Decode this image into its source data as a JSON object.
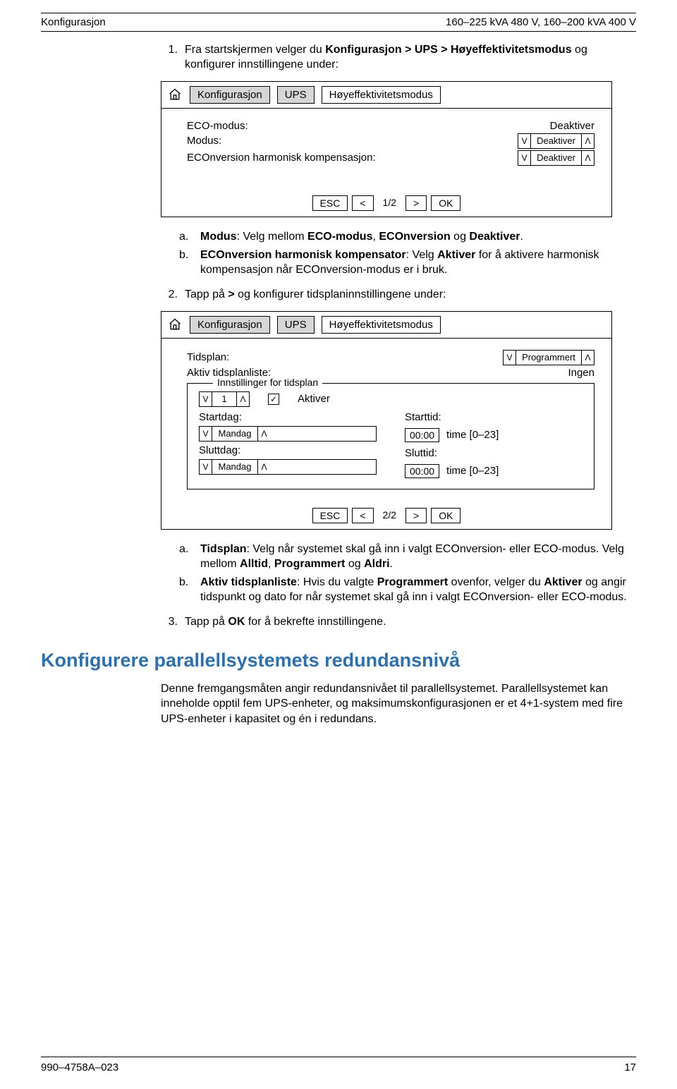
{
  "header": {
    "left": "Konfigurasjon",
    "right": "160–225 kVA 480 V, 160–200 kVA 400 V"
  },
  "step1": {
    "num": "1.",
    "text_a": "Fra startskjermen velger du ",
    "path": "Konfigurasjon > UPS > Høyeffektivitetsmodus",
    "text_b": " og konfigurer innstillingene under:"
  },
  "panel1": {
    "crumb1": "Konfigurasjon",
    "crumb2": "UPS",
    "crumb3": "Høyeffektivitetsmodus",
    "rows": {
      "eco_label": "ECO-modus:",
      "eco_value": "Deaktiver",
      "modus_label": "Modus:",
      "modus_value": "Deaktiver",
      "harm_label": "ECOnversion harmonisk kompensasjon:",
      "harm_value": "Deaktiver"
    },
    "nav": {
      "esc": "ESC",
      "prev": "<",
      "page": "1/2",
      "next": ">",
      "ok": "OK"
    }
  },
  "sublist1": {
    "a": {
      "letter": "a.",
      "lead": "Modus",
      "rest": ": Velg mellom ",
      "opts": "ECO-modus",
      "c1": ", ",
      "opt2": "ECOnversion",
      "c2": " og ",
      "opt3": "Deaktiver",
      "end": "."
    },
    "b": {
      "letter": "b.",
      "lead": "ECOnversion harmonisk kompensator",
      "rest": ": Velg ",
      "opt1": "Aktiver",
      "rest2": " for å aktivere harmonisk kompensasjon når ECOnversion-modus er i bruk."
    }
  },
  "step2": {
    "num": "2.",
    "text_a": "Tapp på ",
    "sym": ">",
    "text_b": " og konfigurer tidsplaninnstillingene under:"
  },
  "panel2": {
    "crumb1": "Konfigurasjon",
    "crumb2": "UPS",
    "crumb3": "Høyeffektivitetsmodus",
    "tidsplan_label": "Tidsplan:",
    "tidsplan_value": "Programmert",
    "aktiv_label": "Aktiv tidsplanliste:",
    "aktiv_value": "Ingen",
    "fieldset_legend": "Innstillinger for tidsplan",
    "idx": "1",
    "aktiver_label": "Aktiver",
    "startdag_label": "Startdag:",
    "startdag_value": "Mandag",
    "starttid_label": "Starttid:",
    "starttid_value": "00:00",
    "time_hint": "time [0–23]",
    "sluttdag_label": "Sluttdag:",
    "sluttdag_value": "Mandag",
    "sluttid_label": "Sluttid:",
    "sluttid_value": "00:00",
    "nav": {
      "esc": "ESC",
      "prev": "<",
      "page": "2/2",
      "next": ">",
      "ok": "OK"
    }
  },
  "sublist2": {
    "a": {
      "letter": "a.",
      "lead": "Tidsplan",
      "rest": ": Velg når systemet skal gå inn i valgt ECOnversion- eller ECO-modus. Velg mellom ",
      "o1": "Alltid",
      "c1": ", ",
      "o2": "Programmert",
      "c2": " og ",
      "o3": "Aldri",
      "end": "."
    },
    "b": {
      "letter": "b.",
      "lead": "Aktiv tidsplanliste",
      "rest": ": Hvis du valgte ",
      "o1": "Programmert",
      "rest2": " ovenfor, velger du ",
      "o2": "Aktiver",
      "rest3": " og angir tidspunkt og dato for når systemet skal gå inn i valgt ECOnversion- eller ECO-modus."
    }
  },
  "step3": {
    "num": "3.",
    "text_a": "Tapp på ",
    "ok": "OK",
    "text_b": " for å bekrefte innstillingene."
  },
  "section2": {
    "title": "Konfigurere parallellsystemets redundansnivå",
    "para": "Denne fremgangsmåten angir redundansnivået til parallellsystemet. Parallellsystemet kan inneholde opptil fem UPS-enheter, og maksimumskonfigurasjonen er et 4+1-system med fire UPS-enheter i kapasitet og én i redundans."
  },
  "footer": {
    "left": "990–4758A–023",
    "right": "17"
  }
}
